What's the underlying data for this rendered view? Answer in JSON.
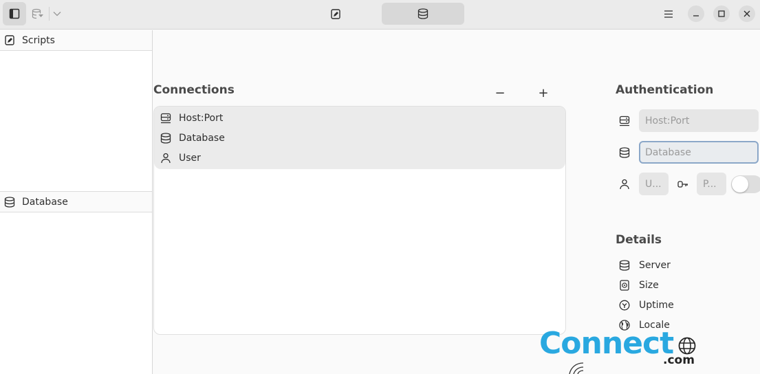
{
  "headerbar": {
    "tabs": [
      {
        "name": "scripts",
        "icon": "edit-icon",
        "active": false
      },
      {
        "name": "database",
        "icon": "database-icon",
        "active": true
      }
    ],
    "icons": {
      "sidebar_toggle": "sidebar-toggle-icon",
      "db_menu": "database-import-icon",
      "dropdown": "chevron-down-icon",
      "main_menu": "hamburger-menu-icon",
      "minimize": "minimize-icon",
      "maximize": "maximize-icon",
      "close": "close-icon"
    }
  },
  "sidebar": {
    "sections": [
      {
        "label": "Scripts",
        "icon": "edit-icon"
      },
      {
        "label": "Database",
        "icon": "database-icon"
      }
    ]
  },
  "connections": {
    "title": "Connections",
    "remove_label": "−",
    "add_label": "+",
    "items": [
      {
        "label": "Host:Port",
        "icon": "server-icon"
      },
      {
        "label": "Database",
        "icon": "database-icon"
      },
      {
        "label": "User",
        "icon": "user-icon"
      }
    ]
  },
  "authentication": {
    "title": "Authentication",
    "host_placeholder": "Host:Port",
    "database_placeholder": "Database",
    "user_placeholder": "U...",
    "password_placeholder": "P...",
    "show_password_toggle": false
  },
  "details": {
    "title": "Details",
    "items": [
      {
        "label": "Server",
        "icon": "database-icon"
      },
      {
        "label": "Size",
        "icon": "disk-icon"
      },
      {
        "label": "Uptime",
        "icon": "clock-icon"
      },
      {
        "label": "Locale",
        "icon": "globe-icon"
      }
    ]
  },
  "watermark": {
    "text": "Connect",
    "suffix": ".com",
    "color": "#29a8e0"
  }
}
